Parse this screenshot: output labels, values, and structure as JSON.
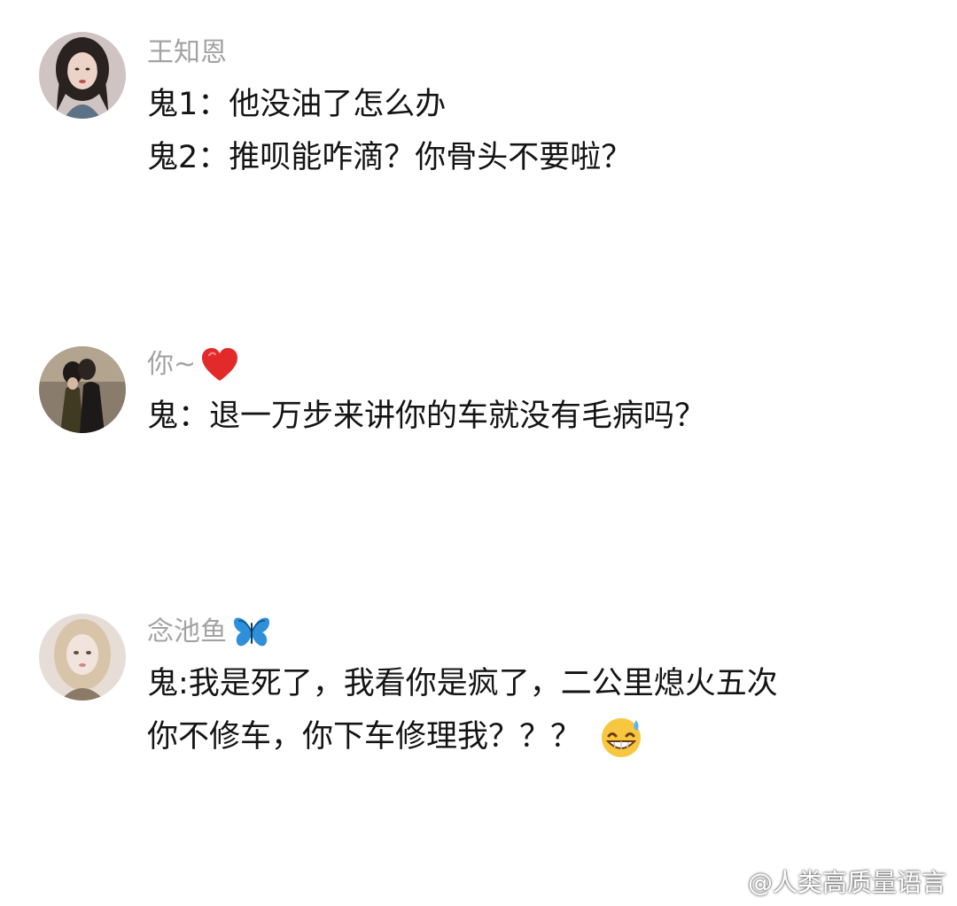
{
  "comments": [
    {
      "username": "王知恩",
      "lines": [
        "鬼1：他没油了怎么办",
        "鬼2：推呗能咋滴？你骨头不要啦？"
      ]
    },
    {
      "username": "你~",
      "username_icon": "red-heart-emoji",
      "lines": [
        "鬼：退一万步来讲你的车就没有毛病吗？"
      ]
    },
    {
      "username": "念池鱼",
      "username_icon": "blue-butterfly-emoji",
      "lines": [
        "鬼:我是死了，我看你是疯了，二公里熄火五次",
        "你不修车，你下车修理我？？？"
      ],
      "trailing_icon": "grinning-sweat-emoji"
    }
  ],
  "watermark": {
    "icon": "weibo-logo-icon",
    "text": "@人类高质量语言"
  }
}
